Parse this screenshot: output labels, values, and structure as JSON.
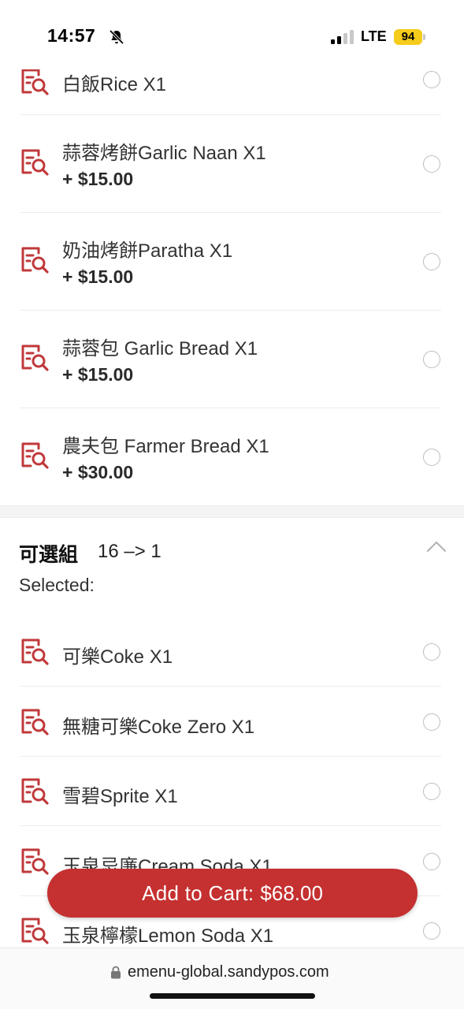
{
  "status_bar": {
    "time": "14:57",
    "network": "LTE",
    "battery": "94"
  },
  "menu_items_upper": [
    {
      "name": "白飯Rice X1",
      "price": ""
    },
    {
      "name": "蒜蓉烤餅Garlic Naan X1",
      "price": "+ $15.00"
    },
    {
      "name": "奶油烤餅Paratha X1",
      "price": "+ $15.00"
    },
    {
      "name": "蒜蓉包 Garlic Bread X1",
      "price": "+ $15.00"
    },
    {
      "name": "農夫包 Farmer Bread X1",
      "price": "+ $30.00"
    }
  ],
  "option_group": {
    "title": "可選組",
    "rule": "16 –> 1",
    "selected_label": "Selected:"
  },
  "menu_items_lower": [
    {
      "name": "可樂Coke X1"
    },
    {
      "name": "無糖可樂Coke Zero X1"
    },
    {
      "name": "雪碧Sprite X1"
    },
    {
      "name": "玉泉忌廉Cream Soda X1"
    },
    {
      "name": "玉泉檸檬Lemon Soda X1"
    }
  ],
  "cart_button": {
    "label": "Add to Cart:",
    "amount": "$68.00"
  },
  "url_bar": {
    "url": "emenu-global.sandypos.com"
  },
  "colors": {
    "accent": "#c53030",
    "icon": "#c0393b",
    "battery": "#f5cc1c"
  }
}
